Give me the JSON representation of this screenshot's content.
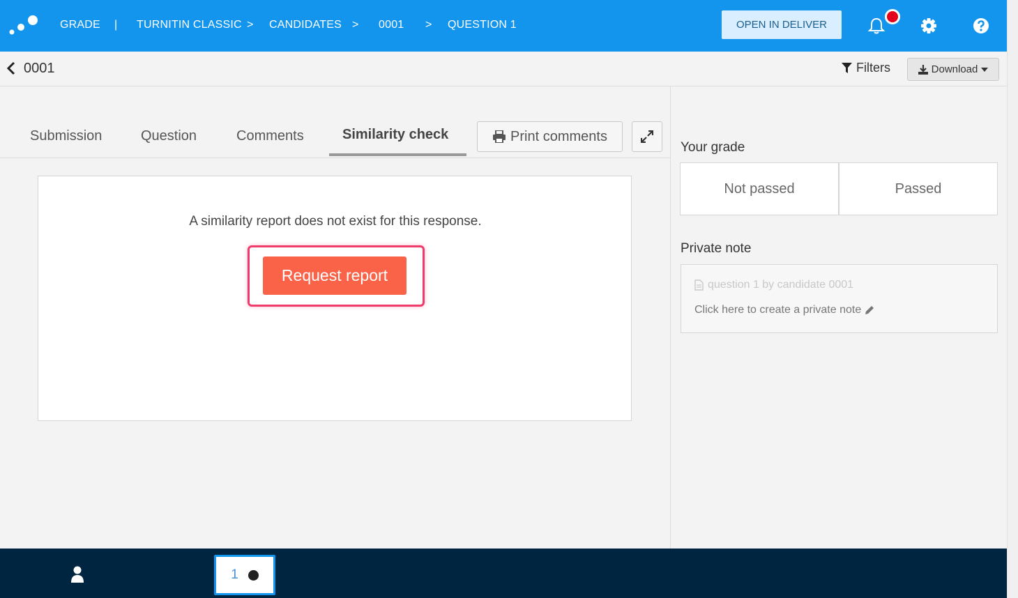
{
  "topbar": {
    "breadcrumbs": [
      "GRADE",
      "TURNITIN CLASSIC",
      "CANDIDATES",
      "0001",
      "QUESTION 1"
    ],
    "separators": [
      "|",
      ">",
      ">",
      ">"
    ],
    "open_deliver_label": "OPEN IN DELIVER",
    "icons": [
      "bell-icon",
      "gear-icon",
      "help-icon"
    ],
    "notification_color": "#e3001b",
    "brand_color": "#1395ee"
  },
  "subheader": {
    "title": "0001",
    "filters_label": "Filters",
    "download_label": "Download"
  },
  "tabs": {
    "items": [
      "Submission",
      "Question",
      "Comments",
      "Similarity check"
    ],
    "active": "Similarity check",
    "print_label": "Print comments"
  },
  "report": {
    "message": "A similarity report does not exist for this response.",
    "request_label": "Request report",
    "button_color": "#fa6347"
  },
  "grade": {
    "label": "Your grade",
    "options": [
      "Not passed",
      "Passed"
    ]
  },
  "private_note": {
    "label": "Private note",
    "meta": "question 1 by candidate 0001",
    "create_label": "Click here to create a private note"
  },
  "bottombar": {
    "candidate_number": "1"
  }
}
